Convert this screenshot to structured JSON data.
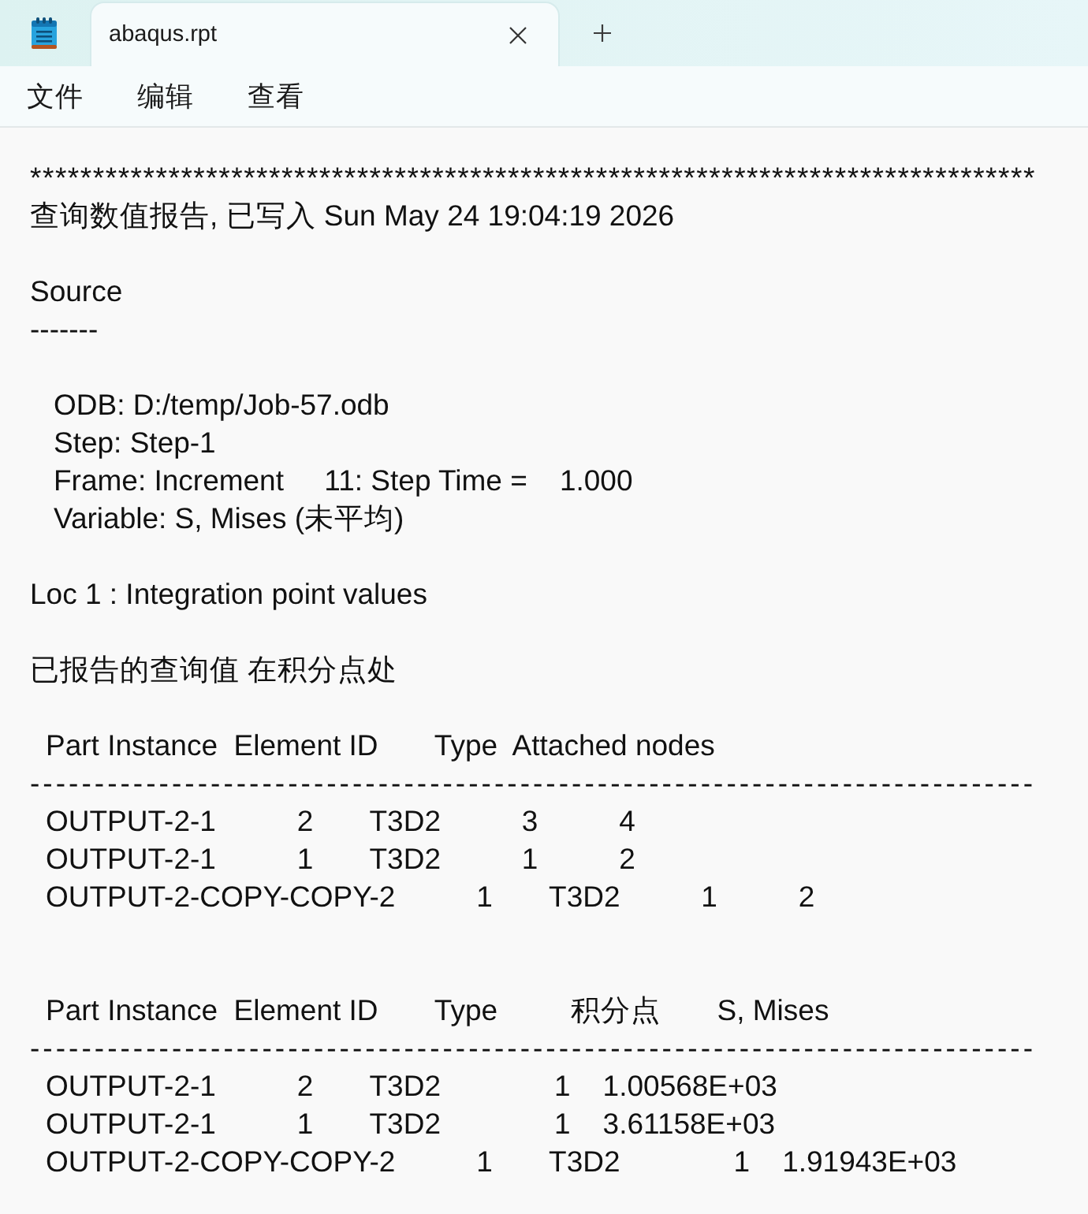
{
  "tabs": [
    {
      "title": "abaqus.rpt",
      "selected": true
    }
  ],
  "menu": [
    "文件",
    "编辑",
    "查看"
  ],
  "document": {
    "lines": [
      {
        "kind": "rule",
        "text": "********************************************************************************"
      },
      {
        "kind": "text",
        "text": "查询数值报告, 已写入 Sun May 24 19:04:19 2026"
      },
      {
        "kind": "blank"
      },
      {
        "kind": "text",
        "text": "Source"
      },
      {
        "kind": "text",
        "text": "-------"
      },
      {
        "kind": "blank"
      },
      {
        "kind": "field",
        "text": "ODB: D:/temp/Job-57.odb"
      },
      {
        "kind": "field",
        "text": "Step: Step-1"
      },
      {
        "kind": "field",
        "text": "Frame: Increment     11: Step Time =    1.000"
      },
      {
        "kind": "field",
        "text": "Variable: S, Mises (未平均)"
      },
      {
        "kind": "blank"
      },
      {
        "kind": "text",
        "text": "Loc 1 : Integration point values"
      },
      {
        "kind": "blank"
      },
      {
        "kind": "text",
        "text": "已报告的查询值 在积分点处"
      },
      {
        "kind": "blank"
      },
      {
        "kind": "table",
        "text": "Part Instance  Element ID       Type  Attached nodes"
      },
      {
        "kind": "rule",
        "text": "------------------------------------------------------------------------------"
      },
      {
        "kind": "table",
        "text": "OUTPUT-2-1          2       T3D2          3          4"
      },
      {
        "kind": "table",
        "text": "OUTPUT-2-1          1       T3D2          1          2"
      },
      {
        "kind": "table",
        "text": "OUTPUT-2-COPY-COPY-2          1       T3D2          1          2"
      },
      {
        "kind": "blank"
      },
      {
        "kind": "blank"
      },
      {
        "kind": "table",
        "text": "Part Instance  Element ID       Type         积分点       S, Mises"
      },
      {
        "kind": "rule",
        "text": "------------------------------------------------------------------------------"
      },
      {
        "kind": "table",
        "text": "OUTPUT-2-1          2       T3D2              1    1.00568E+03"
      },
      {
        "kind": "table",
        "text": "OUTPUT-2-1          1       T3D2              1    3.61158E+03"
      },
      {
        "kind": "table",
        "text": "OUTPUT-2-COPY-COPY-2          1       T3D2              1    1.91943E+03"
      }
    ]
  }
}
